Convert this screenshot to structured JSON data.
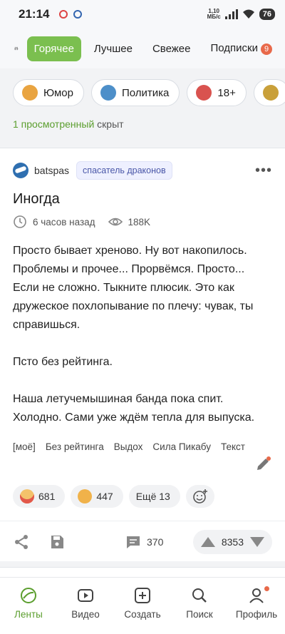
{
  "status_bar": {
    "time": "21:14",
    "net_speed_value": "1,10",
    "net_speed_unit": "МБ/с",
    "battery": "76"
  },
  "top_nav": {
    "tabs": [
      {
        "label": "Горячее",
        "active": true
      },
      {
        "label": "Лучшее"
      },
      {
        "label": "Свежее"
      },
      {
        "label": "Подписки",
        "badge": "9"
      }
    ]
  },
  "tags": [
    {
      "label": "Юмор",
      "icon": "humor-icon"
    },
    {
      "label": "Политика",
      "icon": "politics-icon"
    },
    {
      "label": "18+",
      "icon": "adult-icon"
    },
    {
      "label": "",
      "icon": "food-icon"
    }
  ],
  "hidden_note": {
    "link": "1 просмотренный",
    "text": " скрыт"
  },
  "post": {
    "author": "batspas",
    "author_badge": "спасатель драконов",
    "title": "Иногда",
    "time": "6 часов назад",
    "views": "188K",
    "paragraphs": [
      "Просто бывает хреново. Ну вот накопилось. Проблемы и прочее... Прорвёмся. Просто... Если не сложно. Тыкните плюсик. Это как дружеское похлопывание по плечу: чувак, ты справишься.",
      "Псто без рейтинга.",
      "Наша летучемышиная банда пока спит. Холодно. Сами уже ждём тепла для выпуска."
    ],
    "tags": [
      "[моё]",
      "Без рейтинга",
      "Выдох",
      "Сила Пикабу",
      "Текст"
    ],
    "reactions": [
      {
        "emoji": "clown-emoji",
        "count": "681"
      },
      {
        "emoji": "clap-emoji",
        "count": "447"
      }
    ],
    "more_reactions": "Ещё 13",
    "comments": "370",
    "rating": "8353"
  },
  "bottom_nav": [
    {
      "label": "Ленты",
      "active": true
    },
    {
      "label": "Видео"
    },
    {
      "label": "Создать"
    },
    {
      "label": "Поиск"
    },
    {
      "label": "Профиль",
      "dot": true
    }
  ],
  "colors": {
    "accent": "#7bbf4f",
    "accent_text": "#5b9e2e",
    "badge": "#e8694a"
  }
}
